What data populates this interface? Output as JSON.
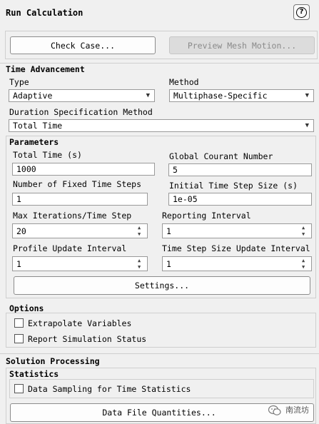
{
  "title": "Run Calculation",
  "help_icon": "?",
  "buttons": {
    "check_case": "Check Case...",
    "preview_mesh_motion": "Preview Mesh Motion..."
  },
  "time_advancement": {
    "heading": "Time Advancement",
    "type_label": "Type",
    "type_value": "Adaptive",
    "method_label": "Method",
    "method_value": "Multiphase-Specific",
    "duration_label": "Duration Specification Method",
    "duration_value": "Total Time"
  },
  "parameters": {
    "heading": "Parameters",
    "total_time_label": "Total Time (s)",
    "total_time_value": "1000",
    "courant_label": "Global Courant Number",
    "courant_value": "5",
    "fixed_steps_label": "Number of Fixed Time Steps",
    "fixed_steps_value": "1",
    "initial_step_label": "Initial Time Step Size (s)",
    "initial_step_value": "1e-05",
    "max_iter_label": "Max Iterations/Time Step",
    "max_iter_value": "20",
    "reporting_label": "Reporting Interval",
    "reporting_value": "1",
    "profile_label": "Profile Update Interval",
    "profile_value": "1",
    "step_size_update_label": "Time Step Size Update Interval",
    "step_size_update_value": "1",
    "settings_button": "Settings..."
  },
  "options": {
    "heading": "Options",
    "extrapolate": "Extrapolate Variables",
    "report_status": "Report Simulation Status"
  },
  "solution_processing": {
    "heading": "Solution Processing",
    "statistics_heading": "Statistics",
    "data_sampling": "Data Sampling for Time Statistics",
    "data_file_button": "Data File Quantities..."
  },
  "watermark": {
    "icon": "wechat-icon",
    "text": "南流坊"
  }
}
